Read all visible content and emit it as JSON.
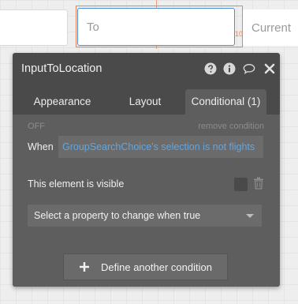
{
  "canvas": {
    "to_input_placeholder": "To",
    "current_input_placeholder": "Current",
    "badge": "10"
  },
  "panel": {
    "title": "InputToLocation",
    "tabs": [
      {
        "label": "Appearance"
      },
      {
        "label": "Layout"
      },
      {
        "label": "Conditional (1)",
        "active": true
      }
    ],
    "condition": {
      "state": "OFF",
      "remove_label": "remove condition",
      "when_label": "When",
      "expression": "GroupSearchChoice's selection is not flights",
      "property_label": "This element is visible",
      "select_placeholder": "Select a property to change when true"
    },
    "define_button_label": "Define another condition"
  },
  "icons": [
    "help-icon",
    "info-icon",
    "comment-icon",
    "close-icon",
    "trash-icon",
    "plus-icon",
    "chevron-down-icon"
  ],
  "colors": {
    "panel_bg": "#4a4a4a",
    "body_bg": "#5e5e5e",
    "expression_text": "#5ba8e8",
    "selection_outline": "#e8845a"
  }
}
